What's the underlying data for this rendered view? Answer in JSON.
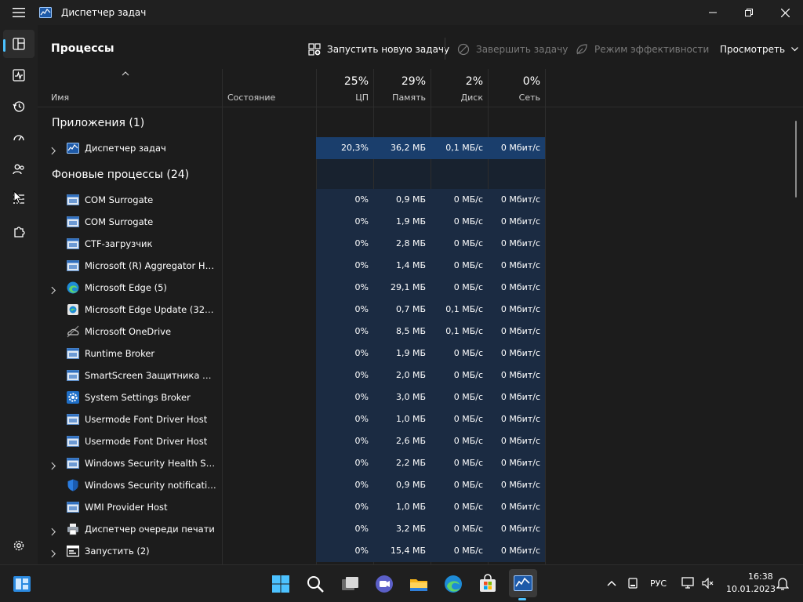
{
  "window": {
    "title": "Диспетчер задач"
  },
  "nav": {
    "items": [
      "Процессы",
      "Производительность",
      "Журнал приложений",
      "Автозагрузка",
      "Пользователи",
      "Подробности",
      "Службы",
      "Параметры"
    ]
  },
  "toolbar": {
    "page_title": "Процессы",
    "run_new_task": "Запустить новую задачу",
    "end_task": "Завершить задачу",
    "efficiency_mode": "Режим эффективности",
    "view": "Просмотреть"
  },
  "columns": {
    "name": "Имя",
    "status": "Состояние",
    "cpu": {
      "pct": "25%",
      "label": "ЦП"
    },
    "memory": {
      "pct": "29%",
      "label": "Память"
    },
    "disk": {
      "pct": "2%",
      "label": "Диск"
    },
    "network": {
      "pct": "0%",
      "label": "Сеть"
    }
  },
  "groups": {
    "apps": "Приложения (1)",
    "background": "Фоновые процессы (24)"
  },
  "apps": [
    {
      "name": "Диспетчер задач",
      "cpu": "20,3%",
      "mem": "36,2 МБ",
      "disk": "0,1 МБ/с",
      "net": "0 Мбит/с",
      "icon": "task-manager-icon",
      "expandable": true
    }
  ],
  "background": [
    {
      "name": "COM Surrogate",
      "cpu": "0%",
      "mem": "0,9 МБ",
      "disk": "0 МБ/с",
      "net": "0 Мбит/с",
      "icon": "window-app-icon",
      "expandable": false
    },
    {
      "name": "COM Surrogate",
      "cpu": "0%",
      "mem": "1,9 МБ",
      "disk": "0 МБ/с",
      "net": "0 Мбит/с",
      "icon": "window-app-icon",
      "expandable": false
    },
    {
      "name": "CTF-загрузчик",
      "cpu": "0%",
      "mem": "2,8 МБ",
      "disk": "0 МБ/с",
      "net": "0 Мбит/с",
      "icon": "window-app-icon",
      "expandable": false
    },
    {
      "name": "Microsoft (R) Aggregator Host",
      "cpu": "0%",
      "mem": "1,4 МБ",
      "disk": "0 МБ/с",
      "net": "0 Мбит/с",
      "icon": "window-app-icon",
      "expandable": false
    },
    {
      "name": "Microsoft Edge (5)",
      "cpu": "0%",
      "mem": "29,1 МБ",
      "disk": "0 МБ/с",
      "net": "0 Мбит/с",
      "icon": "edge-icon",
      "expandable": true
    },
    {
      "name": "Microsoft Edge Update (32 би...",
      "cpu": "0%",
      "mem": "0,7 МБ",
      "disk": "0,1 МБ/с",
      "net": "0 Мбит/с",
      "icon": "edge-update-icon",
      "expandable": false
    },
    {
      "name": "Microsoft OneDrive",
      "cpu": "0%",
      "mem": "8,5 МБ",
      "disk": "0,1 МБ/с",
      "net": "0 Мбит/с",
      "icon": "onedrive-icon",
      "expandable": false
    },
    {
      "name": "Runtime Broker",
      "cpu": "0%",
      "mem": "1,9 МБ",
      "disk": "0 МБ/с",
      "net": "0 Мбит/с",
      "icon": "window-app-icon",
      "expandable": false
    },
    {
      "name": "SmartScreen Защитника Win...",
      "cpu": "0%",
      "mem": "2,0 МБ",
      "disk": "0 МБ/с",
      "net": "0 Мбит/с",
      "icon": "window-app-icon",
      "expandable": false
    },
    {
      "name": "System Settings Broker",
      "cpu": "0%",
      "mem": "3,0 МБ",
      "disk": "0 МБ/с",
      "net": "0 Мбит/с",
      "icon": "settings-gear-icon",
      "expandable": false
    },
    {
      "name": "Usermode Font Driver Host",
      "cpu": "0%",
      "mem": "1,0 МБ",
      "disk": "0 МБ/с",
      "net": "0 Мбит/с",
      "icon": "window-app-icon",
      "expandable": false
    },
    {
      "name": "Usermode Font Driver Host",
      "cpu": "0%",
      "mem": "2,6 МБ",
      "disk": "0 МБ/с",
      "net": "0 Мбит/с",
      "icon": "window-app-icon",
      "expandable": false
    },
    {
      "name": "Windows Security Health Servi...",
      "cpu": "0%",
      "mem": "2,2 МБ",
      "disk": "0 МБ/с",
      "net": "0 Мбит/с",
      "icon": "window-app-icon",
      "expandable": true
    },
    {
      "name": "Windows Security notification...",
      "cpu": "0%",
      "mem": "0,9 МБ",
      "disk": "0 МБ/с",
      "net": "0 Мбит/с",
      "icon": "shield-icon",
      "expandable": false
    },
    {
      "name": "WMI Provider Host",
      "cpu": "0%",
      "mem": "1,0 МБ",
      "disk": "0 МБ/с",
      "net": "0 Мбит/с",
      "icon": "window-app-icon",
      "expandable": false
    },
    {
      "name": "Диспетчер очереди печати",
      "cpu": "0%",
      "mem": "3,2 МБ",
      "disk": "0 МБ/с",
      "net": "0 Мбит/с",
      "icon": "printer-icon",
      "expandable": true
    },
    {
      "name": "Запустить (2)",
      "cpu": "0%",
      "mem": "15,4 МБ",
      "disk": "0 МБ/с",
      "net": "0 Мбит/с",
      "icon": "run-dialog-icon",
      "expandable": true
    }
  ],
  "taskbar": {
    "apps": [
      "Пуск",
      "Поиск",
      "Представление задач",
      "Чат",
      "Проводник",
      "Microsoft Edge",
      "Microsoft Store",
      "Диспетчер задач"
    ],
    "lang": "РУС",
    "time": "16:38",
    "date": "10.01.2023"
  },
  "colors": {
    "accent": "#4cc2ff",
    "cell_light": "#1b2b42",
    "cell_strong": "#1a3e6c",
    "background": "#1c1c1c",
    "rail": "#202020"
  }
}
